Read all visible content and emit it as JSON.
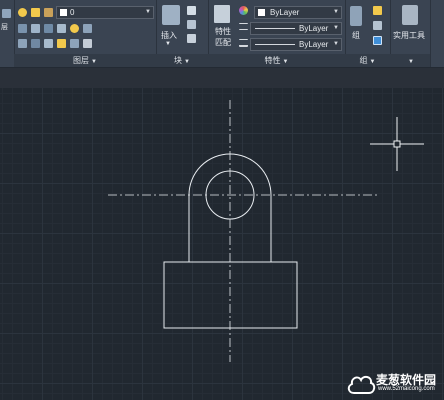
{
  "ribbon": {
    "layers": {
      "current_layer": "0",
      "title": "图层"
    },
    "block": {
      "insert_label": "插入",
      "title": "块"
    },
    "properties": {
      "match_label_line1": "特性",
      "match_label_line2": "匹配",
      "color_value": "ByLayer",
      "linetype_value": "ByLayer",
      "lineweight_value": "ByLayer",
      "title": "特性"
    },
    "groups": {
      "group_label": "组",
      "title": "组"
    },
    "utilities": {
      "label": "实用工具"
    },
    "left_panel_partial_label": "层"
  },
  "watermark": {
    "text": "麦葱软件园",
    "url": "www.52maicong.com"
  },
  "colors": {
    "ribbon_bg": "#3a4452",
    "canvas_bg": "#212830",
    "drawing_lines": "#e8ecf0",
    "accent_yellow": "#f2c94c"
  }
}
